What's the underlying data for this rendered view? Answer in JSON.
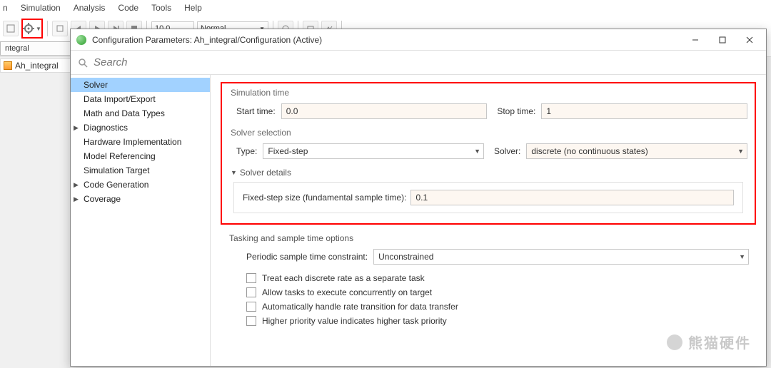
{
  "menubar": {
    "items": [
      "n",
      "Simulation",
      "Analysis",
      "Code",
      "Tools",
      "Help"
    ]
  },
  "toolbar": {
    "time_box": "10.0",
    "mode_combo": "Normal"
  },
  "doc": {
    "tab": "ntegral",
    "file": "Ah_integral"
  },
  "dialog": {
    "title": "Configuration Parameters: Ah_integral/Configuration (Active)",
    "search_placeholder": "Search",
    "sidebar": {
      "items": [
        {
          "label": "Solver",
          "selected": true,
          "expand": false
        },
        {
          "label": "Data Import/Export",
          "selected": false,
          "expand": false
        },
        {
          "label": "Math and Data Types",
          "selected": false,
          "expand": false
        },
        {
          "label": "Diagnostics",
          "selected": false,
          "expand": true
        },
        {
          "label": "Hardware Implementation",
          "selected": false,
          "expand": false
        },
        {
          "label": "Model Referencing",
          "selected": false,
          "expand": false
        },
        {
          "label": "Simulation Target",
          "selected": false,
          "expand": false
        },
        {
          "label": "Code Generation",
          "selected": false,
          "expand": true
        },
        {
          "label": "Coverage",
          "selected": false,
          "expand": true
        }
      ]
    },
    "sim_time": {
      "title": "Simulation time",
      "start_label": "Start time:",
      "start_value": "0.0",
      "stop_label": "Stop time:",
      "stop_value": "1"
    },
    "solver_sel": {
      "title": "Solver selection",
      "type_label": "Type:",
      "type_value": "Fixed-step",
      "solver_label": "Solver:",
      "solver_value": "discrete (no continuous states)"
    },
    "solver_details": {
      "title": "Solver details",
      "step_label": "Fixed-step size (fundamental sample time):",
      "step_value": "0.1"
    },
    "tasking": {
      "title": "Tasking and sample time options",
      "constraint_label": "Periodic sample time constraint:",
      "constraint_value": "Unconstrained",
      "cb1": "Treat each discrete rate as a separate task",
      "cb2": "Allow tasks to execute concurrently on target",
      "cb3": "Automatically handle rate transition for data transfer",
      "cb4": "Higher priority value indicates higher task priority"
    }
  },
  "watermark": "熊猫硬件"
}
